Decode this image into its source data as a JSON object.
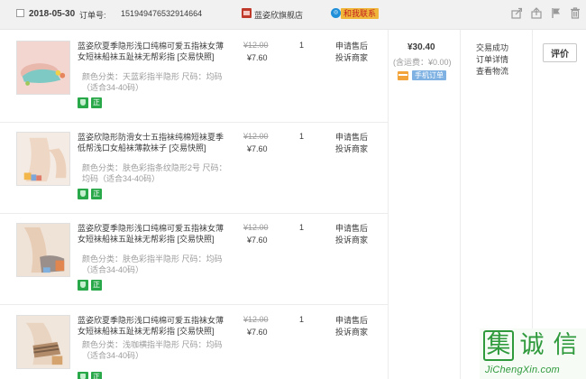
{
  "order": {
    "date": "2018-05-30",
    "order_label": "订单号:",
    "order_no": "151949476532914664",
    "shop_name": "蓝姿欣旗舰店",
    "contact_label": "和我联系",
    "total": "¥30.40",
    "freight": "(含运费：¥0.00)",
    "mobile_label": "手机订单",
    "status": [
      "交易成功",
      "订单详情",
      "查看物流"
    ],
    "review_label": "评价"
  },
  "header_actions": [
    "share-icon",
    "upload-icon",
    "flag-icon",
    "delete-icon"
  ],
  "items": [
    {
      "title": "蓝姿欣夏季隐形浅口纯棉可爱五指袜女薄女短袜船袜五趾袜无帮彩指 [交易快照]",
      "spec": "颜色分类：天蓝彩指半隐形 尺码：均码（适合34-40码）",
      "price_old": "¥12.00",
      "price_new": "¥7.60",
      "qty": "1",
      "after_sale": [
        "申请售后",
        "投诉商家"
      ]
    },
    {
      "title": "蓝姿欣隐形防滑女士五指袜纯棉短袜夏季低帮浅口女船袜薄款袜子 [交易快照]",
      "spec": "颜色分类：肤色彩指条纹隐形2号 尺码：均码（适合34-40码）",
      "price_old": "¥12.00",
      "price_new": "¥7.60",
      "qty": "1",
      "after_sale": [
        "申请售后",
        "投诉商家"
      ]
    },
    {
      "title": "蓝姿欣夏季隐形浅口纯棉可爱五指袜女薄女短袜船袜五趾袜无帮彩指 [交易快照]",
      "spec": "颜色分类：肤色彩指半隐形 尺码：均码（适合34-40码）",
      "price_old": "¥12.00",
      "price_new": "¥7.60",
      "qty": "1",
      "after_sale": [
        "申请售后",
        "投诉商家"
      ]
    },
    {
      "title": "蓝姿欣夏季隐形浅口纯棉可爱五指袜女薄女短袜船袜五趾袜无帮彩指 [交易快照]",
      "spec": "颜色分类：浅咖横指半隐形 尺码：均码（适合34-40码）",
      "price_old": "¥12.00",
      "price_new": "¥7.60",
      "qty": "1",
      "after_sale": [
        "申请售后",
        "投诉商家"
      ]
    }
  ],
  "tags": [
    "guarantee-icon",
    "正"
  ],
  "watermark": {
    "chars": [
      "集",
      "诚",
      "信"
    ],
    "url": "JiChengXin.com"
  },
  "colors": {
    "header_bg": "#f1f1f1",
    "contact_bg": "#f0b63a",
    "tag_green": "#29a84a",
    "watermark_green": "#2f9a3c"
  }
}
